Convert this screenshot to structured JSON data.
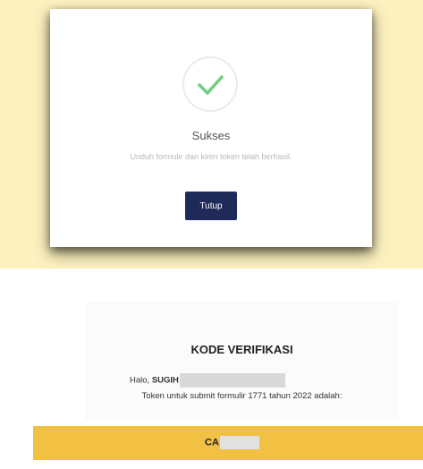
{
  "modal": {
    "icon": "checkmark-icon",
    "title": "Sukses",
    "message": "Unduh formulir dan kirim token telah berhasil.",
    "close_label": "Tutup"
  },
  "email": {
    "title": "KODE VERIFIKASI",
    "greeting": "Halo,",
    "name_visible": "SUGIH",
    "token_text": "Token untuk submit formulir 1771 tahun 2022 adalah:",
    "token_visible": "CA"
  },
  "colors": {
    "page_background": "#fdf2bf",
    "check": "#6fcf7a",
    "button": "#1f2a5a",
    "token_bar": "#f2c042"
  }
}
